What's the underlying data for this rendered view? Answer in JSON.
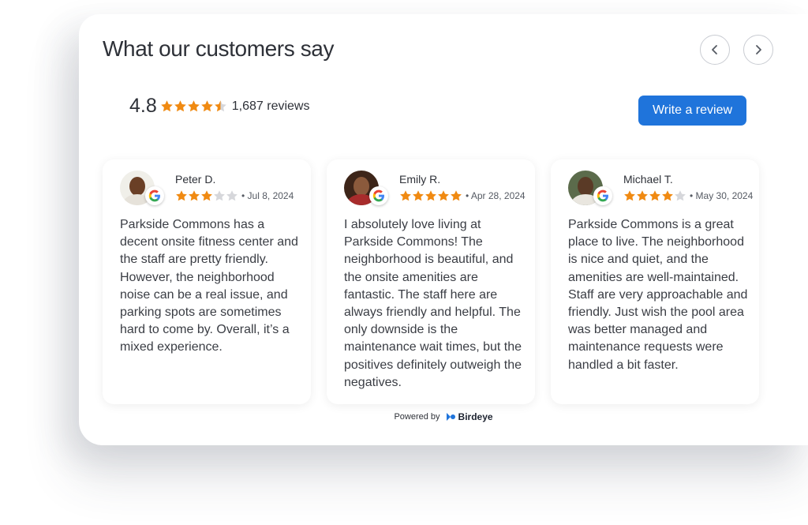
{
  "header": {
    "title": "What our customers say"
  },
  "summary": {
    "rating": "4.8",
    "rating_value": 4.5,
    "review_count": "1,687 reviews"
  },
  "actions": {
    "write_review_label": "Write a review"
  },
  "colors": {
    "star_filled": "#f08a12",
    "star_empty": "#d6d7db",
    "accent": "#1f74db"
  },
  "reviews": [
    {
      "name": "Peter D.",
      "stars": 3,
      "date": "Jul 8, 2024",
      "text": "Parkside Commons has a decent onsite fitness center and the staff are pretty friendly. However, the neighborhood noise can be a real issue, and parking spots are sometimes hard to come by. Overall, it’s a mixed experience."
    },
    {
      "name": "Emily R.",
      "stars": 5,
      "date": "Apr 28, 2024",
      "text": "I absolutely love living at Parkside Commons! The neighborhood is beautiful, and the onsite amenities are fantastic. The staff here are always friendly and helpful. The only downside is the maintenance wait times, but the positives definitely outweigh the negatives."
    },
    {
      "name": "Michael T.",
      "stars": 4,
      "date": "May 30, 2024",
      "text": "Parkside Commons is a great place to live. The neighborhood is nice and quiet, and the amenities are well-maintained. Staff are very approachable and friendly. Just wish the pool area was better managed and maintenance requests were handled a bit faster."
    }
  ],
  "footer": {
    "powered_by": "Powered by",
    "brand": "Birdeye"
  }
}
